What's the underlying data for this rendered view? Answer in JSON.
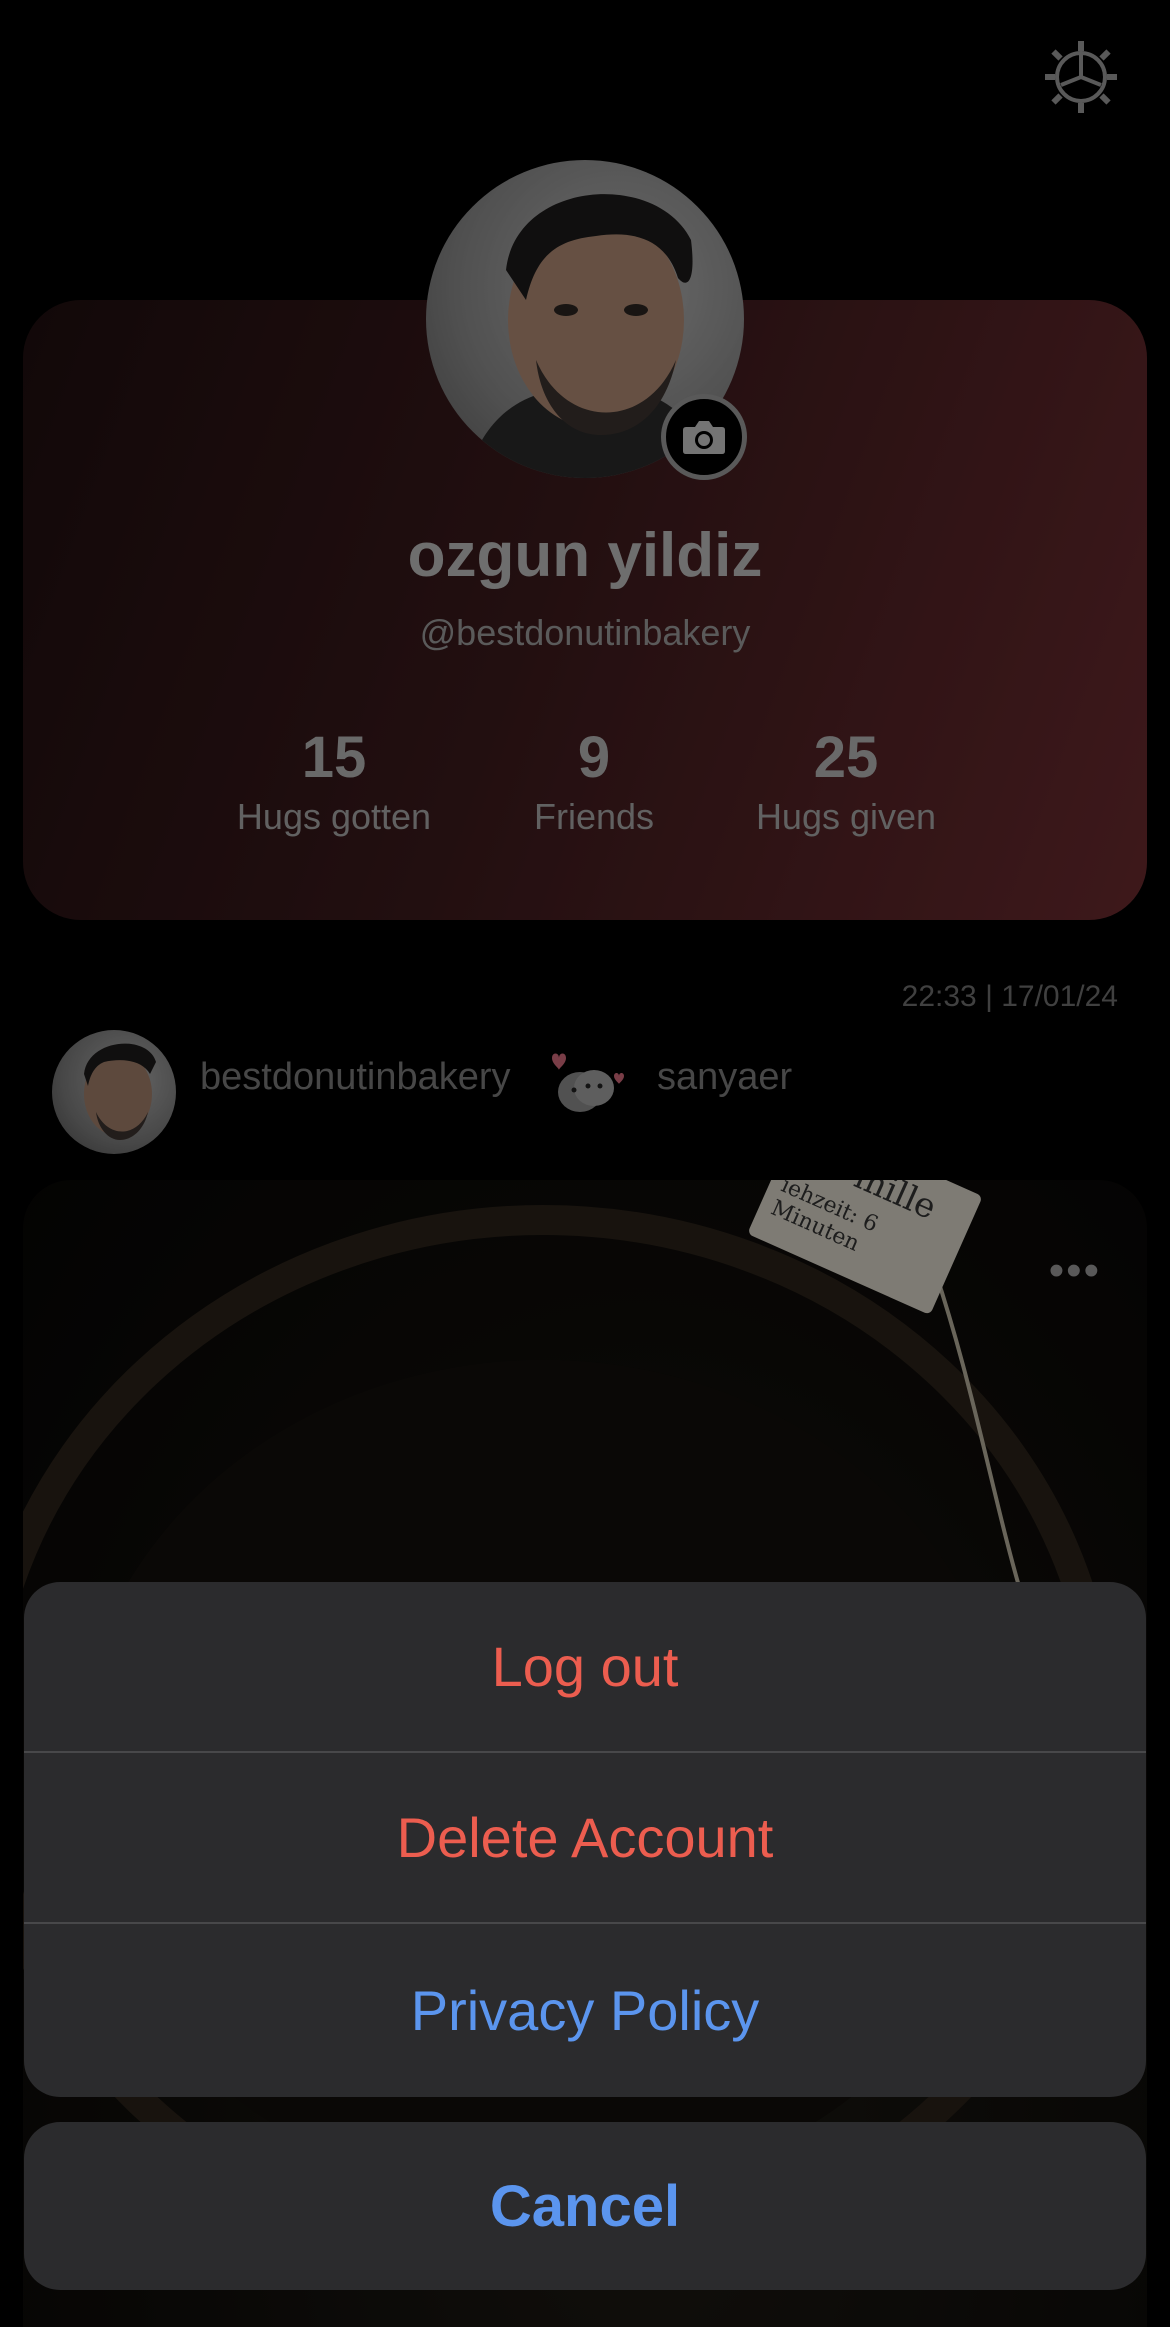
{
  "profile": {
    "display_name": "ozgun yildiz",
    "username": "@bestdonutinbakery",
    "stats": [
      {
        "value": "15",
        "label": "Hugs gotten"
      },
      {
        "value": "9",
        "label": "Friends"
      },
      {
        "value": "25",
        "label": "Hugs given"
      }
    ]
  },
  "feed": {
    "timestamp": "22:33 | 17/01/24",
    "sender": "bestdonutinbakery",
    "recipient": "sanyaer",
    "more_label": "•••",
    "photo_text": [
      "mille",
      "iehzeit: 6 Minuten"
    ]
  },
  "action_sheet": {
    "items": [
      {
        "label": "Log out",
        "style": "destructive"
      },
      {
        "label": "Delete Account",
        "style": "destructive"
      },
      {
        "label": "Privacy Policy",
        "style": "default"
      }
    ],
    "cancel_label": "Cancel"
  },
  "icons": {
    "settings": "gear-icon",
    "camera": "camera-icon",
    "hug": "hug-sticker-icon"
  },
  "colors": {
    "destructive": "#ec5d4f",
    "action_blue": "#5b95ee",
    "sheet_bg": "#2b2b2d"
  }
}
